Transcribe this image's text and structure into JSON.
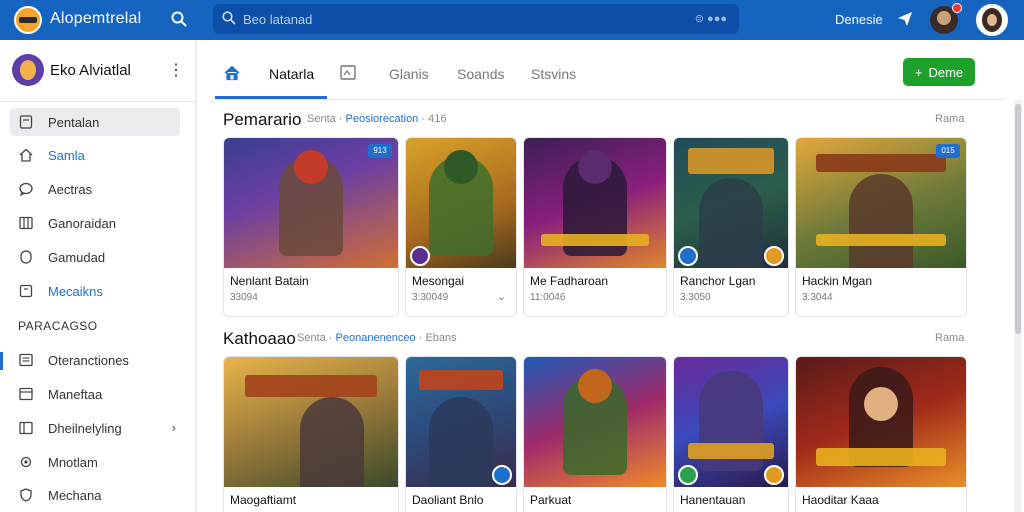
{
  "topbar": {
    "app_title": "Alopemtrelal",
    "search_placeholder": "Beo latanad",
    "search_shortcut": "⊜ ●●●",
    "user_label": "Denesie",
    "colors": {
      "bar": "#1565c0",
      "search": "#0d4ea8"
    },
    "icons": [
      "search-icon",
      "send-icon"
    ]
  },
  "sidebar": {
    "profile_name": "Eko Alviatlal",
    "menu_glyph": "⋮",
    "items": [
      {
        "label": "Pentalan",
        "icon": "document-icon",
        "active": true,
        "blue": false
      },
      {
        "label": "Samla",
        "icon": "home-icon",
        "active": false,
        "blue": true
      },
      {
        "label": "Aectras",
        "icon": "chat-icon",
        "active": false,
        "blue": false
      },
      {
        "label": "Ganoraidan",
        "icon": "grid-icon",
        "active": false,
        "blue": false
      },
      {
        "label": "Gamudad",
        "icon": "circle-icon",
        "active": false,
        "blue": false
      },
      {
        "label": "Mecaikns",
        "icon": "box-icon",
        "active": false,
        "blue": true
      }
    ],
    "section_title": "PARACAGSO",
    "section_items": [
      {
        "label": "Oteranctiones",
        "icon": "list-icon",
        "selected": true
      },
      {
        "label": "Maneftaa",
        "icon": "window-icon",
        "selected": false
      },
      {
        "label": "Dheilnelyling",
        "icon": "panel-icon",
        "selected": false,
        "has_chevron": true
      },
      {
        "label": "Mnotlam",
        "icon": "gear-icon",
        "selected": false
      },
      {
        "label": "Mechana",
        "icon": "shield-icon",
        "selected": false
      }
    ],
    "chevron": "›"
  },
  "main": {
    "tabs": [
      {
        "label": "Natarla",
        "active": true
      },
      {
        "label": "Glanis",
        "active": false
      },
      {
        "label": "Soands",
        "active": false
      },
      {
        "label": "Stsvins",
        "active": false
      }
    ],
    "cta_label": "Deme",
    "cta_plus": "+",
    "rows": [
      {
        "title": "Pemarario",
        "meta_prefix": "Senta ·",
        "meta_highlight": "Peosiorecation",
        "meta_suffix": "· 416",
        "link": "Rama",
        "cards": [
          {
            "title": "Nenlant Batain",
            "sub": "33094",
            "badge": "913"
          },
          {
            "title": "Mesongai",
            "sub": "3:30049",
            "badge": "",
            "chevron": "⌄"
          },
          {
            "title": "Me Fadharoan",
            "sub": "11:0046",
            "badge": ""
          },
          {
            "title": "Ranchor Lgan",
            "sub": "3:3050",
            "badge": ""
          },
          {
            "title": "Hackin Mgan",
            "sub": "3:3044",
            "badge": "015"
          }
        ]
      },
      {
        "title": "Kathoaao",
        "meta_prefix": "Senta ·",
        "meta_highlight": "Peonanenenceo",
        "meta_suffix": "· Ebans",
        "link": "Rama",
        "cards": [
          {
            "title": "Maogaftiamt",
            "sub": "",
            "badge": ""
          },
          {
            "title": "Daoliant Bnlo",
            "sub": "",
            "badge": ""
          },
          {
            "title": "Parkuat",
            "sub": "",
            "badge": ""
          },
          {
            "title": "Hanentauan",
            "sub": "",
            "badge": ""
          },
          {
            "title": "Haoditar Kaaa",
            "sub": "",
            "badge": ""
          }
        ]
      }
    ]
  }
}
